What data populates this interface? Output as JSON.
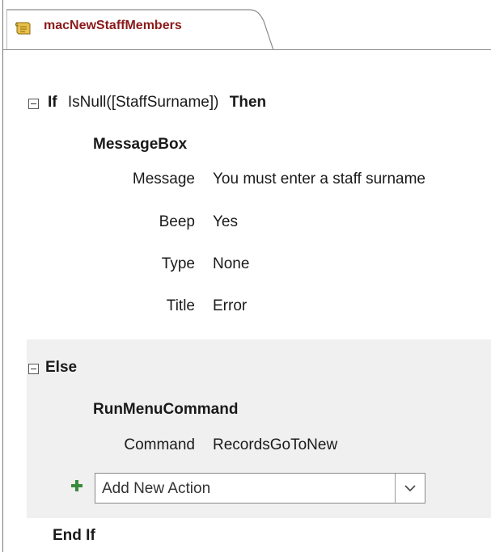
{
  "tab": {
    "title": "macNewStaffMembers",
    "icon": "macro-scroll-icon"
  },
  "if_block": {
    "keyword_if": "If",
    "condition": "IsNull([StaffSurname])",
    "keyword_then": "Then",
    "action": {
      "name": "MessageBox",
      "args": [
        {
          "name": "Message",
          "value": "You must enter a staff surname"
        },
        {
          "name": "Beep",
          "value": "Yes"
        },
        {
          "name": "Type",
          "value": "None"
        },
        {
          "name": "Title",
          "value": "Error"
        }
      ]
    }
  },
  "else_block": {
    "keyword_else": "Else",
    "action": {
      "name": "RunMenuCommand",
      "args": [
        {
          "name": "Command",
          "value": "RecordsGoToNew"
        }
      ]
    },
    "add_action": {
      "placeholder": "Add New Action"
    }
  },
  "end_if": "End If",
  "colors": {
    "tab_title": "#8b1a1a",
    "else_background": "#f0f0f0",
    "plus_green": "#3a8a3a"
  }
}
